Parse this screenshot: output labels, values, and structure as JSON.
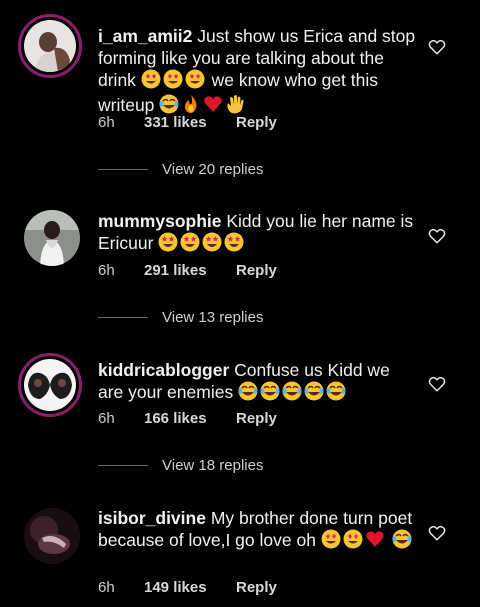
{
  "comments": [
    {
      "username": "i_am_amii2",
      "text_parts": [
        "Just show us Erica and stop forming like you are talking about the drink ",
        " we know who get this writeup "
      ],
      "time": "6h",
      "likes": "331 likes",
      "reply": "Reply",
      "replies": "View 20 replies"
    },
    {
      "username": "mummysophie",
      "text": "Kidd you lie her name is Ericuur ",
      "time": "6h",
      "likes": "291 likes",
      "reply": "Reply",
      "replies": "View 13 replies"
    },
    {
      "username": "kiddricablogger",
      "text": "Confuse us Kidd we are your enemies ",
      "time": "6h",
      "likes": "166 likes",
      "reply": "Reply",
      "replies": "View 18 replies"
    },
    {
      "username": "isibor_divine",
      "text": "My brother done turn poet because of love,I go love oh ",
      "time": "6h",
      "likes": "149 likes",
      "reply": "Reply"
    }
  ],
  "icons": {
    "heart": "heart-outline-icon",
    "emoji_heart_eyes": "heart-eyes-emoji",
    "emoji_star_struck": "star-struck-emoji",
    "emoji_laughing": "tears-of-joy-emoji",
    "emoji_fire": "fire-emoji",
    "emoji_red_heart": "red-heart-emoji",
    "emoji_wave": "waving-hand-emoji"
  },
  "colors": {
    "background": "#000000",
    "story_ring": "#8c1f6a",
    "text": "#f0f0f0",
    "meta": "#cfcfcf"
  }
}
